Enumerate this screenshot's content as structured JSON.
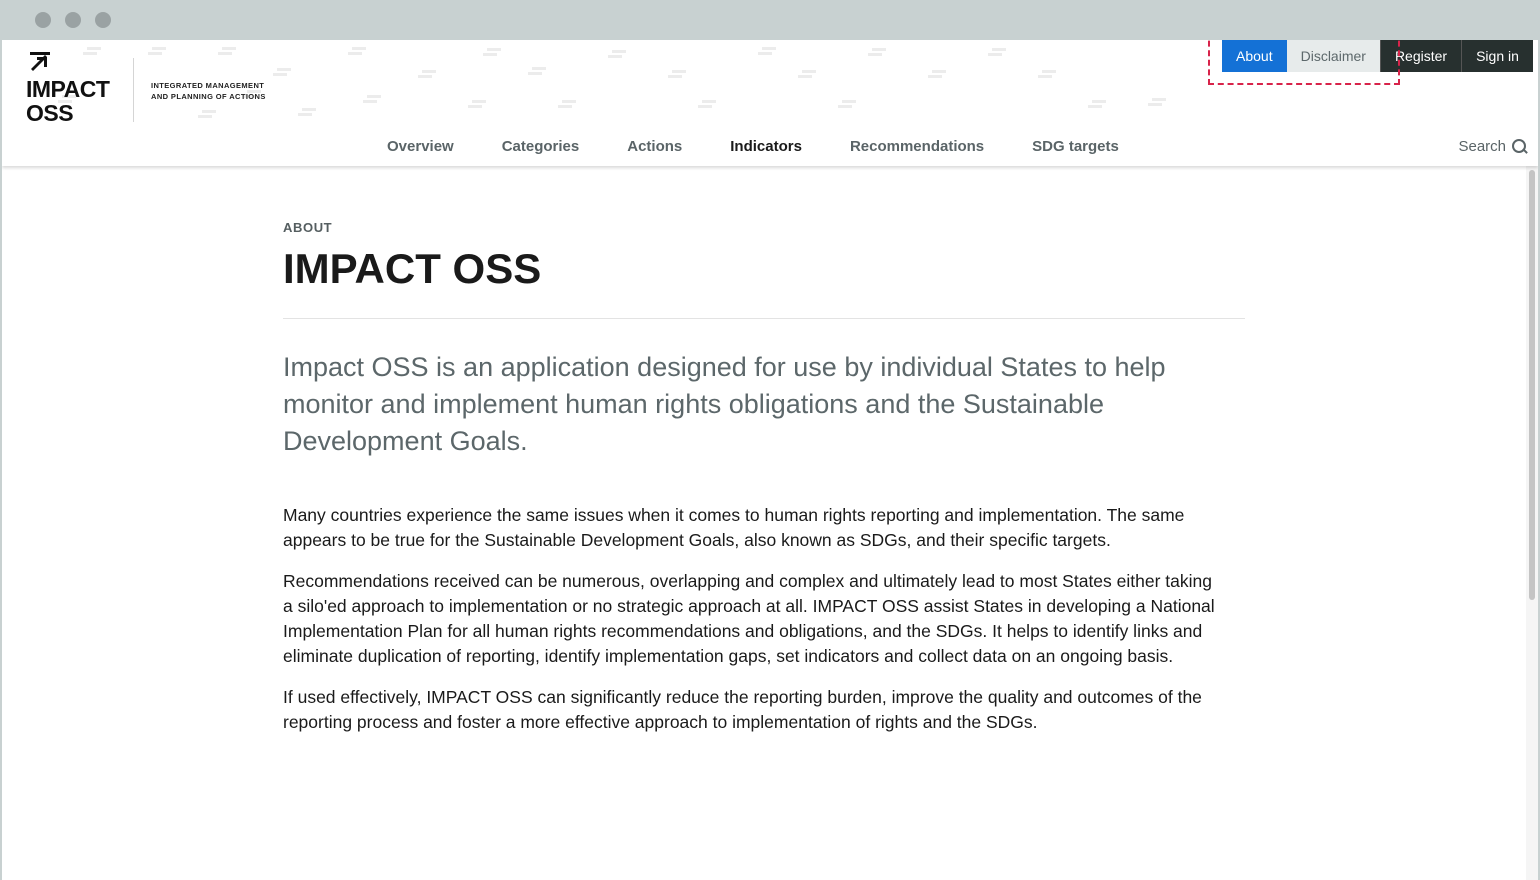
{
  "brand": {
    "name_line1": "IMPACT",
    "name_line2": "OSS",
    "tagline_line1": "INTEGRATED MANAGEMENT",
    "tagline_line2": "AND PLANNING OF ACTIONS"
  },
  "utility_nav": {
    "about": "About",
    "disclaimer": "Disclaimer",
    "register": "Register",
    "sign_in": "Sign in"
  },
  "main_nav": {
    "items": [
      "Overview",
      "Categories",
      "Actions",
      "Indicators",
      "Recommendations",
      "SDG targets"
    ],
    "active": "Indicators"
  },
  "search": {
    "label": "Search",
    "icon": "search-icon"
  },
  "page": {
    "eyebrow": "ABOUT",
    "title": "IMPACT OSS",
    "lead": "Impact OSS is an application designed for use by individual States to help monitor and implement human rights obligations and the Sustainable Development Goals.",
    "paragraphs": [
      "Many countries experience the same issues when it comes to human rights reporting and implementation. The same appears to be true for the Sustainable Development Goals, also known as SDGs, and their specific targets.",
      "Recommendations received can be numerous, overlapping and complex and ultimately lead to most States either taking a silo'ed approach to implementation or no strategic approach at all. IMPACT OSS assist States in developing a National Implementation Plan for all human rights recommendations and obligations, and the SDGs. It helps to identify links and eliminate duplication of reporting, identify implementation gaps, set indicators and collect data on an ongoing basis.",
      "If used effectively, IMPACT OSS can significantly reduce the reporting burden, improve the quality and outcomes of the reporting process and foster a more effective approach to implementation of rights and the SDGs."
    ]
  },
  "colors": {
    "accent": "#1471d6",
    "dark_nav": "#27302f",
    "highlight": "#d8234a"
  }
}
